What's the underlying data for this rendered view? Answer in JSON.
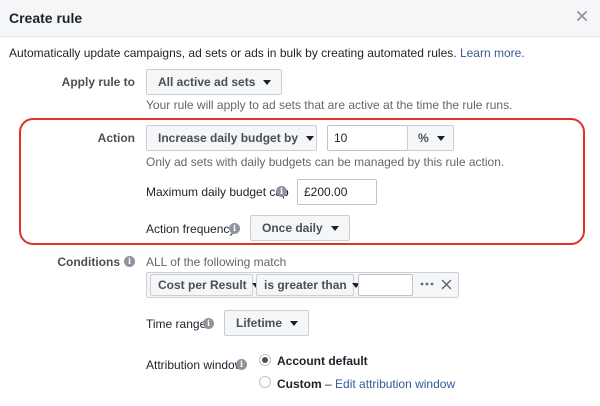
{
  "header": {
    "title": "Create rule",
    "close_icon": "close-icon"
  },
  "intro": {
    "text": "Automatically update campaigns, ad sets or ads in bulk by creating automated rules.",
    "link": "Learn more."
  },
  "apply_rule": {
    "label": "Apply rule to",
    "value": "All active ad sets",
    "help": "Your rule will apply to ad sets that are active at the time the rule runs."
  },
  "action": {
    "label": "Action",
    "type_value": "Increase daily budget by",
    "amount_value": "10",
    "unit_value": "%",
    "help": "Only ad sets with daily budgets can be managed by this rule action.",
    "max_cap_label": "Maximum daily budget cap",
    "max_cap_value": "£200.00",
    "frequency_label": "Action frequency",
    "frequency_value": "Once daily",
    "highlight_color": "#e1312c"
  },
  "conditions": {
    "label": "Conditions",
    "match_text": "ALL of the following match",
    "metric_value": "Cost per Result",
    "operator_value": "is greater than",
    "value": "",
    "more_icon": "ellipsis-icon",
    "remove_icon": "close-icon"
  },
  "time_range": {
    "label": "Time range",
    "value": "Lifetime"
  },
  "attribution": {
    "label": "Attribution window",
    "option_default": "Account default",
    "option_custom": "Custom",
    "custom_dash": "–",
    "custom_link": "Edit attribution window"
  },
  "colors": {
    "link": "#385898",
    "header_bg": "#f5f6f7",
    "info_icon": "#8d949e"
  }
}
